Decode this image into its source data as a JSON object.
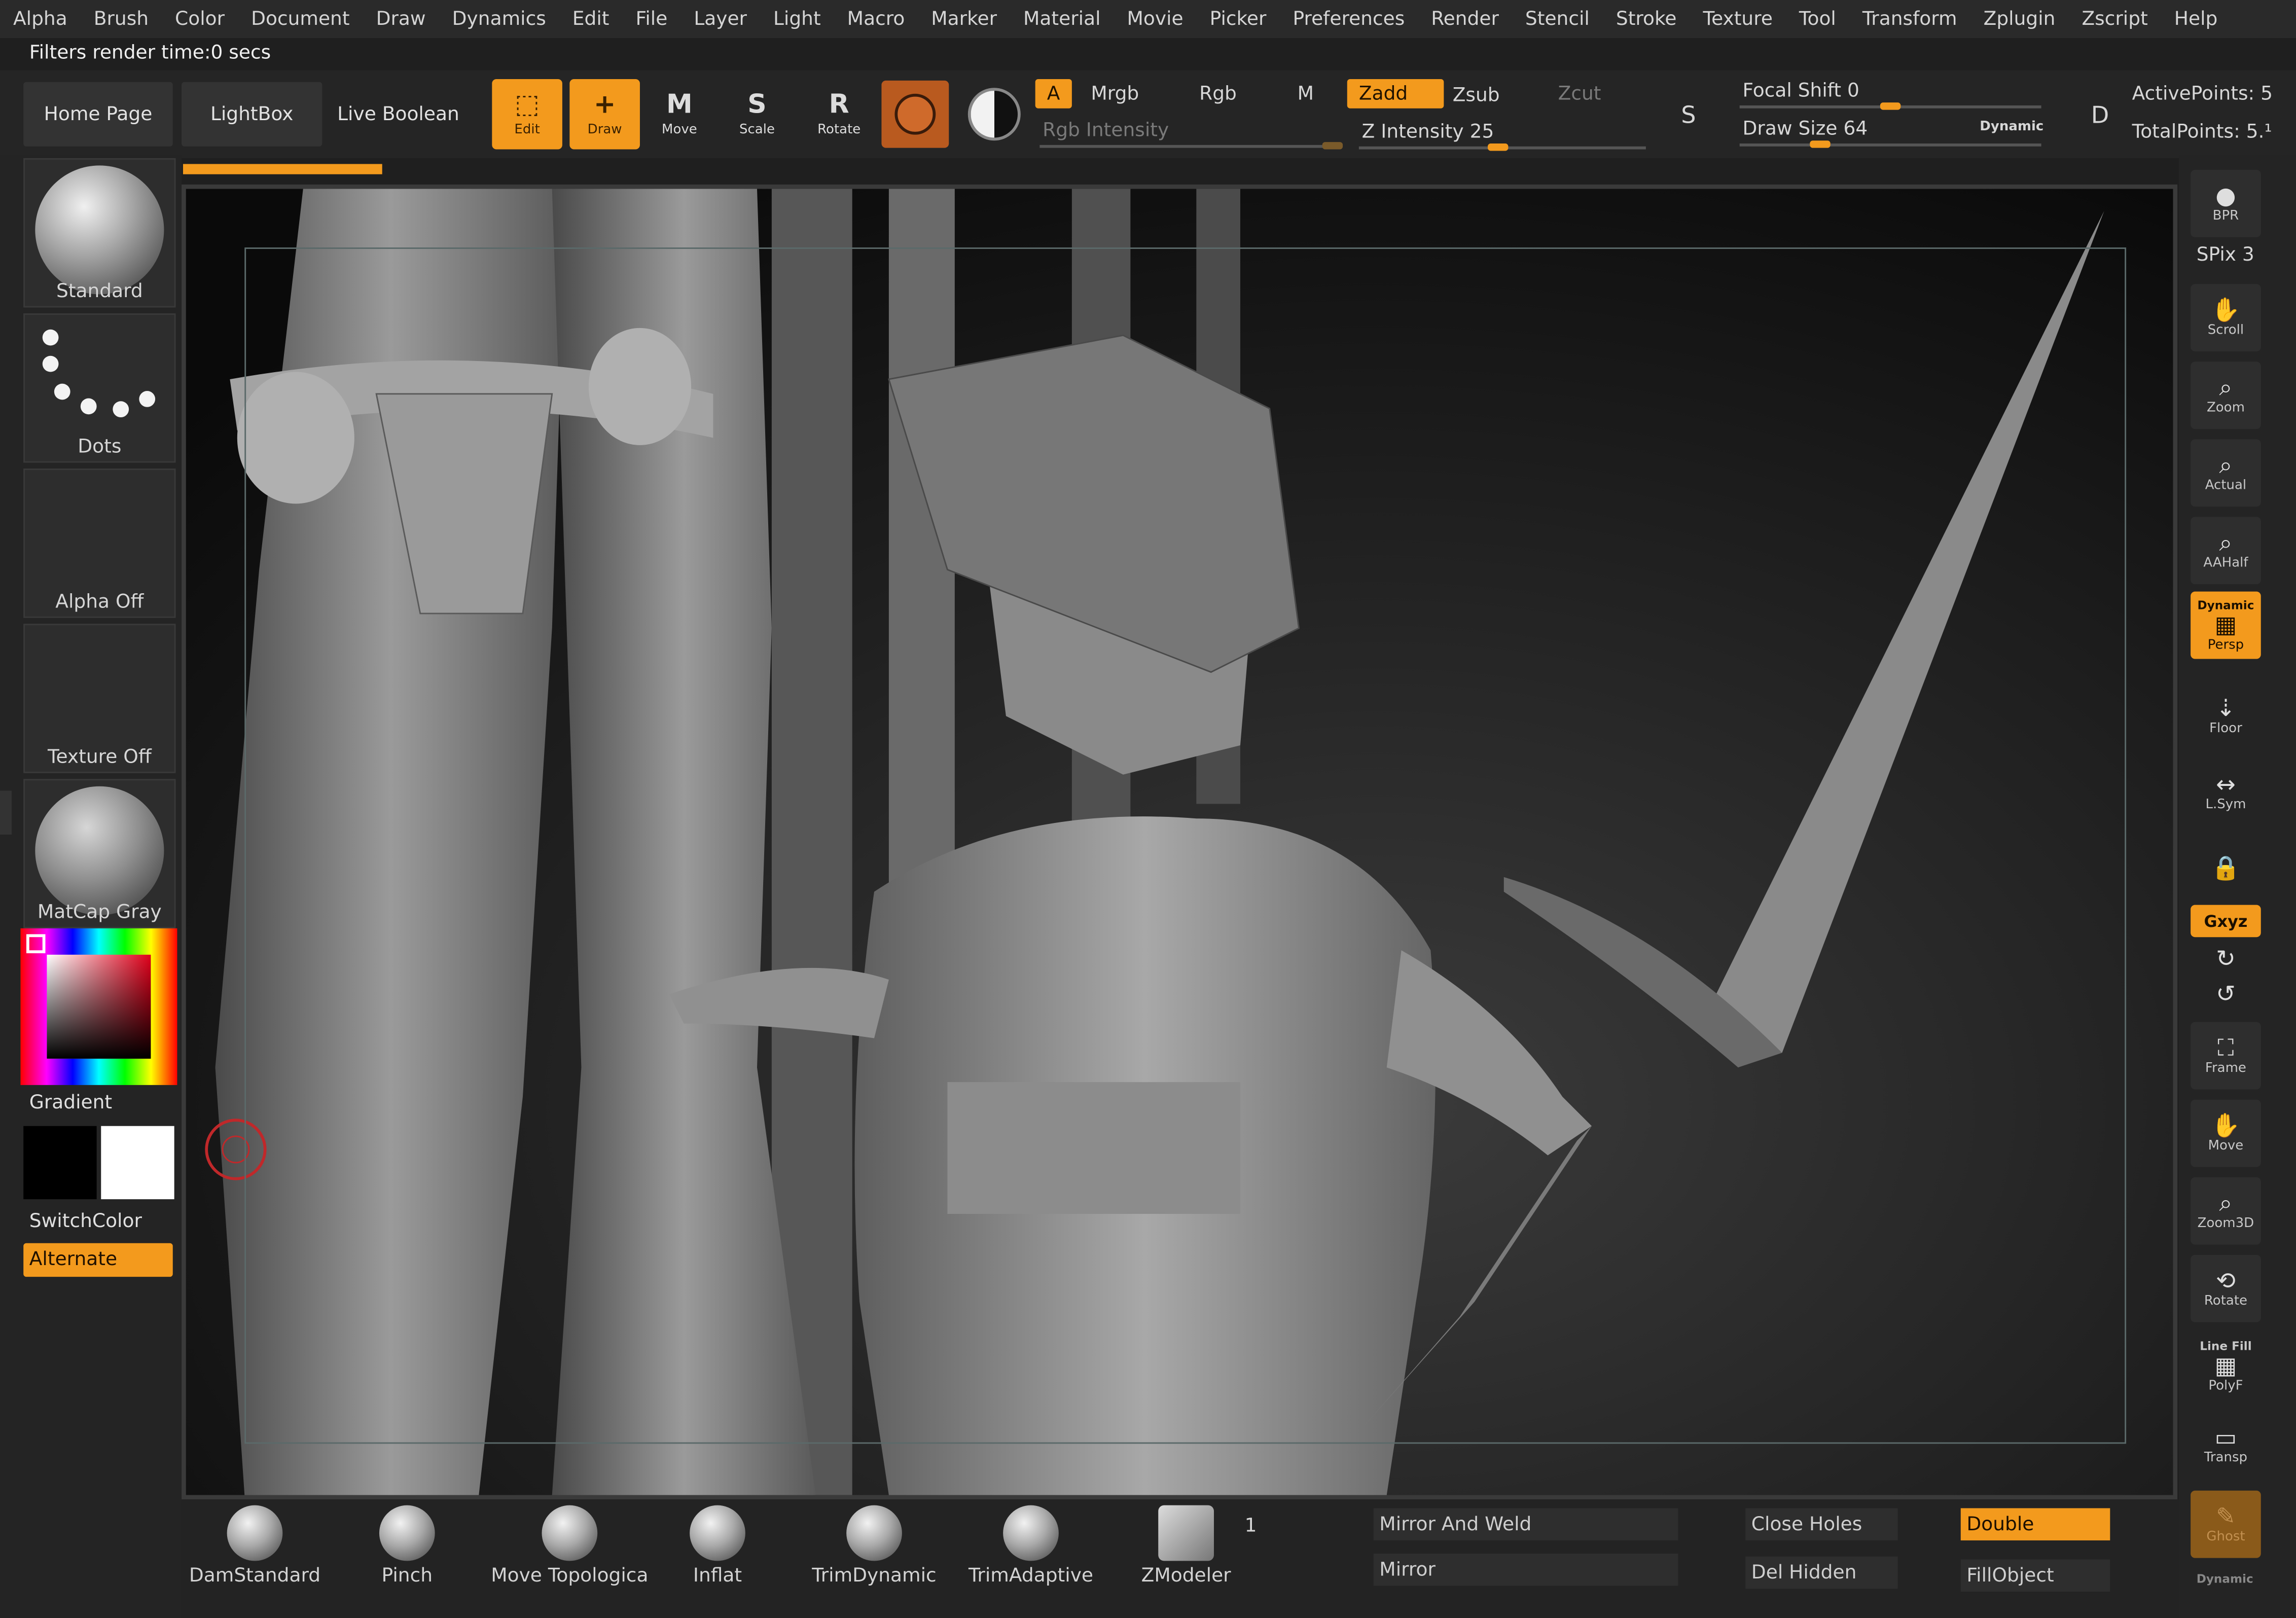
{
  "menu": [
    "Alpha",
    "Brush",
    "Color",
    "Document",
    "Draw",
    "Dynamics",
    "Edit",
    "File",
    "Layer",
    "Light",
    "Macro",
    "Marker",
    "Material",
    "Movie",
    "Picker",
    "Preferences",
    "Render",
    "Stencil",
    "Stroke",
    "Texture",
    "Tool",
    "Transform",
    "Zplugin",
    "Zscript",
    "Help"
  ],
  "status": {
    "render_time": "Filters render time:0 secs"
  },
  "nav": {
    "home": "Home Page",
    "lightbox": "LightBox",
    "live_boolean": "Live Boolean"
  },
  "tools": {
    "edit": {
      "glyph": "⬚",
      "label": "Edit"
    },
    "draw": {
      "glyph": "+",
      "label": "Draw"
    },
    "move": {
      "glyph": "M",
      "label": "Move"
    },
    "scale": {
      "glyph": "S",
      "label": "Scale"
    },
    "rotate": {
      "glyph": "R",
      "label": "Rotate"
    }
  },
  "channels": {
    "a": "A",
    "mrgb": "Mrgb",
    "rgb": "Rgb",
    "m": "M",
    "rgb_intensity": "Rgb Intensity",
    "zadd": "Zadd",
    "zsub": "Zsub",
    "zcut": "Zcut",
    "z_intensity": "Z Intensity 25"
  },
  "brush": {
    "focal_shift": "Focal Shift 0",
    "draw_size": "Draw Size 64",
    "dynamic": "Dynamic",
    "s_label": "S",
    "d_label": "D"
  },
  "points": {
    "active": "ActivePoints: 5",
    "total": "TotalPoints: 5.¹"
  },
  "left_shelf": {
    "standard": "Standard",
    "dots": "Dots",
    "alpha_off": "Alpha Off",
    "texture_off": "Texture Off",
    "matcap": "MatCap Gray",
    "gradient": "Gradient",
    "switch_color": "SwitchColor",
    "alternate": "Alternate"
  },
  "right_shelf": {
    "bpr": "BPR",
    "spix": "SPix 3",
    "scroll": "Scroll",
    "zoom": "Zoom",
    "actual": "Actual",
    "aahalf": "AAHalf",
    "dynamic": "Dynamic",
    "persp": "Persp",
    "floor": "Floor",
    "lsym": "L.Sym",
    "xyz": "Gxyz",
    "frame": "Frame",
    "move": "Move",
    "zoom3d": "Zoom3D",
    "rotate": "Rotate",
    "line_fill": "Line Fill",
    "polyf": "PolyF",
    "transp": "Transp",
    "ghost": "Ghost",
    "dynamic2": "Dynamic"
  },
  "bottom_shelf": {
    "brushes": [
      "DamStandard",
      "Pinch",
      "Move Topologica",
      "Inflat",
      "TrimDynamic",
      "TrimAdaptive",
      "ZModeler"
    ],
    "zmodeler_count": "1",
    "mirror_and_weld": "Mirror And Weld",
    "mirror": "Mirror",
    "close_holes": "Close Holes",
    "del_hidden": "Del Hidden",
    "double": "Double",
    "fill_object": "FillObject"
  },
  "colors": {
    "accent": "#f39a1d",
    "primary": "#000000",
    "secondary": "#ffffff"
  },
  "icons": {
    "move_icon": "move-icon",
    "scale_icon": "scale-icon",
    "rotate_icon": "rotate-icon",
    "material_icon": "material-swatch",
    "yin_icon": "yin-yang-icon"
  }
}
